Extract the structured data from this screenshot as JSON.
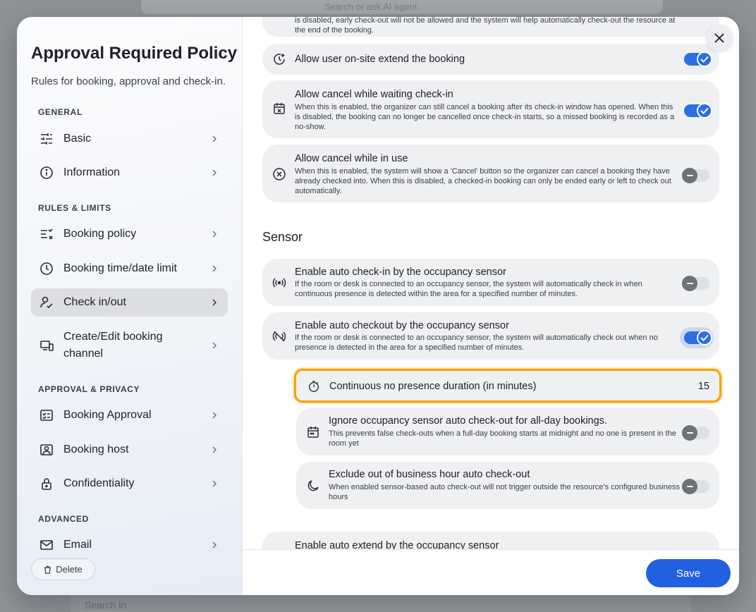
{
  "background": {
    "search_text": "Search or ask AI agent",
    "bottom_text": "Search in"
  },
  "sidebar": {
    "title": "Approval Required Policy",
    "subtitle": "Rules for booking, approval and check-in.",
    "sections": {
      "general": "GENERAL",
      "rules": "RULES & LIMITS",
      "approval": "APPROVAL & PRIVACY",
      "advanced": "ADVANCED"
    },
    "items": [
      {
        "label": "Basic",
        "icon": "sliders-icon"
      },
      {
        "label": "Information",
        "icon": "info-icon"
      },
      {
        "label": "Booking policy",
        "icon": "list-check-icon"
      },
      {
        "label": "Booking time/date limit",
        "icon": "clock-icon"
      },
      {
        "label": "Check in/out",
        "icon": "user-check-icon",
        "active": true
      },
      {
        "label": "Create/Edit booking channel",
        "icon": "devices-icon"
      },
      {
        "label": "Booking Approval",
        "icon": "approval-icon"
      },
      {
        "label": "Booking host",
        "icon": "host-icon"
      },
      {
        "label": "Confidentiality",
        "icon": "lock-icon"
      },
      {
        "label": "Email",
        "icon": "mail-icon"
      }
    ],
    "delete_label": "Delete"
  },
  "content": {
    "top_partial_text": "is disabled, early check-out will not be allowed and the system will help automatically check-out the resource at the end of the booking.",
    "settings": [
      {
        "title": "Allow user on-site extend the booking",
        "desc": "",
        "enabled": true
      },
      {
        "title": "Allow cancel while waiting check-in",
        "desc": "When this is enabled, the organizer can still cancel a booking after its check-in window has opened. When this is disabled, the booking can no longer be cancelled once check-in starts, so a missed booking is recorded as a no-show.",
        "enabled": true
      },
      {
        "title": "Allow cancel while in use",
        "desc": "When this is enabled, the system will show a 'Cancel' button so the organizer can cancel a booking they have already checked into. When this is disabled, a checked-in booking can only be ended early or left to check out automatically.",
        "enabled": false
      }
    ],
    "sensor_heading": "Sensor",
    "sensor_settings": [
      {
        "title": "Enable auto check-in by the occupancy sensor",
        "desc": "If the room or desk is connected to an occupancy sensor, the system will automatically check in when continuous presence is detected within the area for a specified number of minutes.",
        "enabled": false
      },
      {
        "title": "Enable auto checkout by the occupancy sensor",
        "desc": "If the room or desk is connected to an occupancy sensor, the system will automatically check out when no presence is detected in the area for a specified number of minutes.",
        "enabled": true
      }
    ],
    "duration": {
      "label": "Continuous no presence duration (in minutes)",
      "value": "15"
    },
    "sub_settings": [
      {
        "title": "Ignore occupancy sensor auto check-out for all-day bookings.",
        "desc": "This prevents false check-outs when a full-day booking starts at midnight and no one is present in the room yet",
        "enabled": false
      },
      {
        "title": "Exclude out of business hour auto check-out",
        "desc": "When enabled sensor-based auto check-out will not trigger outside the resource's configured business hours",
        "enabled": false
      }
    ],
    "partial_bottom_title": "Enable auto extend by the occupancy sensor"
  },
  "footer": {
    "save_label": "Save"
  },
  "colors": {
    "accent": "#2160e0",
    "highlight": "#f4a300"
  }
}
